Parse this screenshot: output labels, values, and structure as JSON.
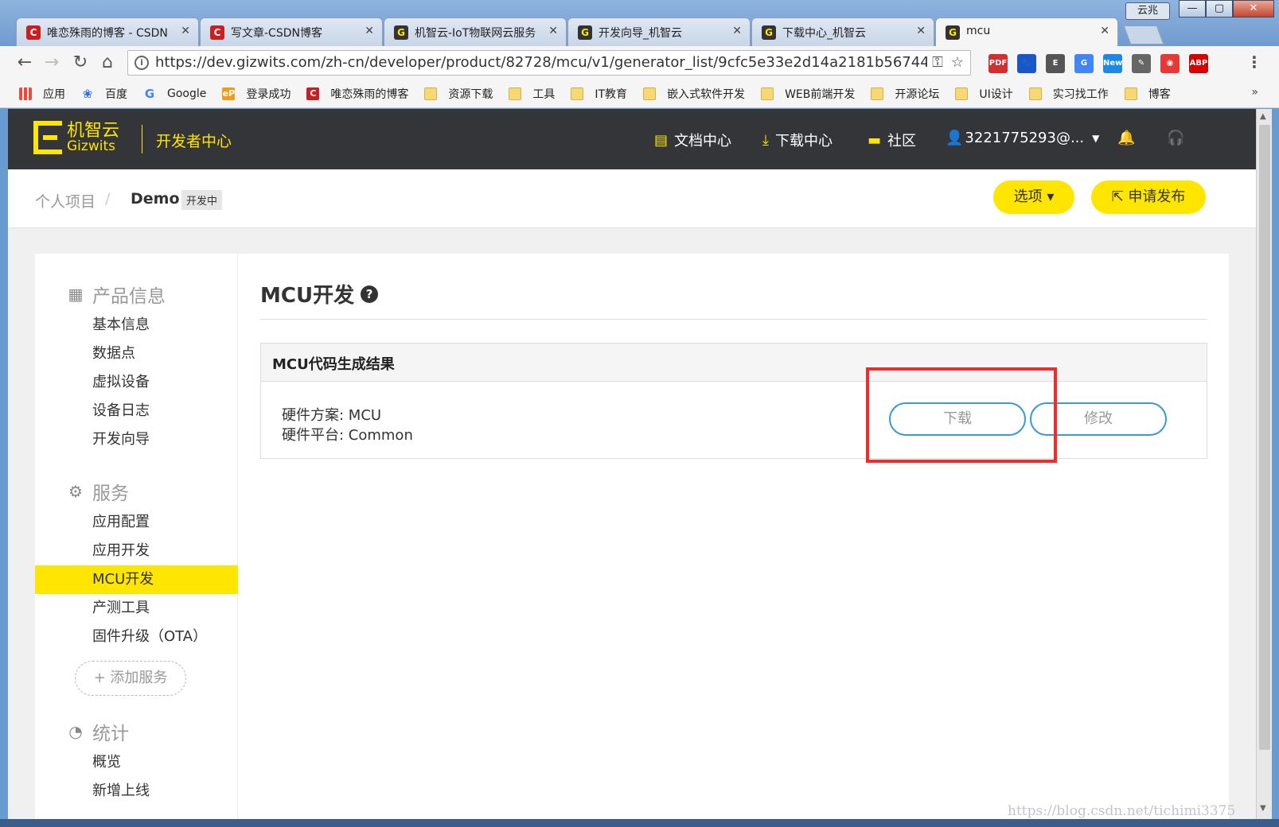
{
  "window": {
    "label": "云兆",
    "min": "—",
    "max": "▢",
    "close": "✕"
  },
  "tabs": [
    {
      "title": "唯恋殊雨的博客 - CSDN",
      "icon": "C"
    },
    {
      "title": "写文章-CSDN博客",
      "icon": "C"
    },
    {
      "title": "机智云-IoT物联网云服务",
      "icon": "G"
    },
    {
      "title": "开发向导_机智云",
      "icon": "G"
    },
    {
      "title": "下载中心_机智云",
      "icon": "G"
    },
    {
      "title": "mcu",
      "icon": "G"
    }
  ],
  "tab_close": "✕",
  "toolbar": {
    "back": "←",
    "forward": "→",
    "reload": "↻",
    "home": "⌂",
    "url": "https://dev.gizwits.com/zh-cn/developer/product/82728/mcu/v1/generator_list/9cfc5e33e2d14a2181b567447...",
    "info": "i",
    "key": "⚿",
    "star": "☆",
    "menu": "⋮"
  },
  "extensions": [
    {
      "name": "pdf-extension-icon",
      "text": "PDF",
      "color": "#d32f2f"
    },
    {
      "name": "paw-extension-icon",
      "text": "🐾",
      "color": "#1a56c8"
    },
    {
      "name": "evernote-extension-icon",
      "text": "E",
      "color": "#555555"
    },
    {
      "name": "translate-extension-icon",
      "text": "G",
      "color": "#4285f4"
    },
    {
      "name": "new-extension-icon",
      "text": "New",
      "color": "#1e88e5"
    },
    {
      "name": "eyedropper-extension-icon",
      "text": "✎",
      "color": "#666666"
    },
    {
      "name": "screenshot-extension-icon",
      "text": "◉",
      "color": "#e53935"
    },
    {
      "name": "adblock-extension-icon",
      "text": "ABP",
      "color": "#d50000"
    }
  ],
  "bookmarks": [
    {
      "label": "应用",
      "icon": "apps"
    },
    {
      "label": "百度",
      "icon": "baidu",
      "glyph": "❀"
    },
    {
      "label": "Google",
      "icon": "google",
      "glyph": "G"
    },
    {
      "label": "登录成功",
      "icon": "ep",
      "glyph": "eP"
    },
    {
      "label": "唯恋殊雨的博客",
      "icon": "csdn",
      "glyph": "C"
    },
    {
      "label": "资源下载",
      "icon": "folder"
    },
    {
      "label": "工具",
      "icon": "folder"
    },
    {
      "label": "IT教育",
      "icon": "folder"
    },
    {
      "label": "嵌入式软件开发",
      "icon": "folder"
    },
    {
      "label": "WEB前端开发",
      "icon": "folder"
    },
    {
      "label": "开源论坛",
      "icon": "folder"
    },
    {
      "label": "UI设计",
      "icon": "folder"
    },
    {
      "label": "实习找工作",
      "icon": "folder"
    },
    {
      "label": "博客",
      "icon": "folder"
    }
  ],
  "bookmarks_more": "»",
  "header": {
    "logo_cn": "机智云",
    "logo_en": "Gizwits",
    "dev_center": "开发者中心",
    "nav": {
      "docs": "文档中心",
      "downloads": "下载中心",
      "community": "社区",
      "user": "3221775293@..."
    },
    "icons": {
      "docs": "▤",
      "downloads": "⤓",
      "community": "▬",
      "user": "👤",
      "bell": "🔔",
      "support": "🎧",
      "caret": "▼"
    }
  },
  "breadcrumb": {
    "parent": "个人项目",
    "sep": "/",
    "current": "Demo",
    "status": "开发中"
  },
  "actions": {
    "options": "选项 ▾",
    "publish": "⇱ 申请发布"
  },
  "sidebar": {
    "groups": [
      {
        "label": "产品信息",
        "icon": "▦"
      },
      {
        "label": "服务",
        "icon": "⚙"
      },
      {
        "label": "统计",
        "icon": "◔"
      }
    ],
    "product_items": [
      "基本信息",
      "数据点",
      "虚拟设备",
      "设备日志",
      "开发向导"
    ],
    "service_items": [
      "应用配置",
      "应用开发",
      "MCU开发",
      "产测工具",
      "固件升级（OTA）"
    ],
    "add_service": "+ 添加服务",
    "stats_items": [
      "概览",
      "新增上线"
    ]
  },
  "main": {
    "title": "MCU开发",
    "help": "?",
    "panel_title": "MCU代码生成结果",
    "hardware_scheme": "硬件方案: MCU",
    "hardware_platform": "硬件平台: Common",
    "download": "下载",
    "modify": "修改"
  },
  "scroll": {
    "up": "▲",
    "down": "▼"
  },
  "watermark": "https://blog.csdn.net/tichimi3375"
}
